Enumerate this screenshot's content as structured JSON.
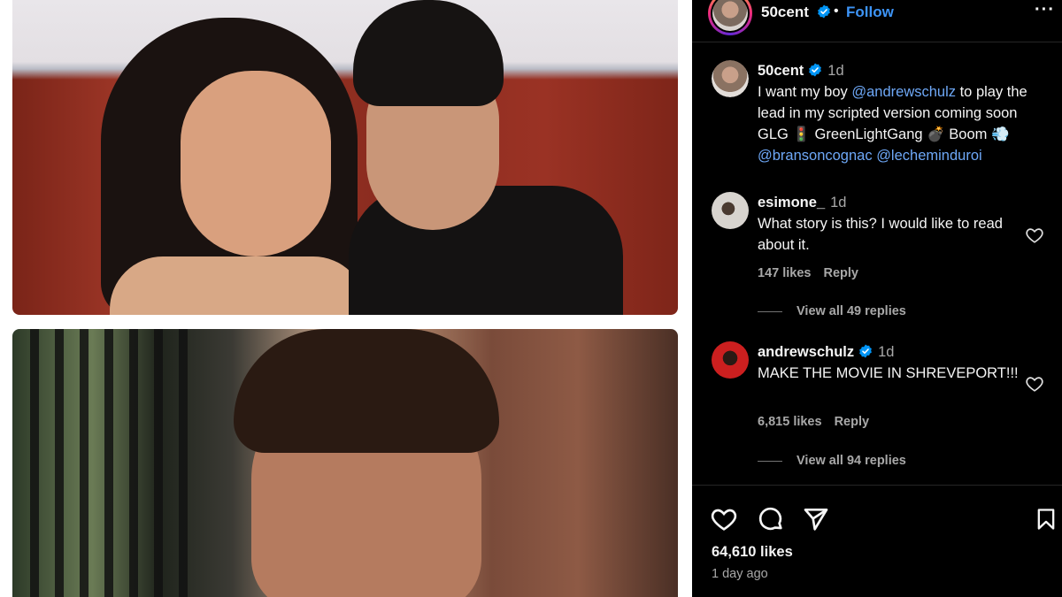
{
  "header": {
    "username": "50cent",
    "separator": "•",
    "follow_label": "Follow",
    "more_label": "···"
  },
  "caption": {
    "username": "50cent",
    "time": "1d",
    "text_1": "I want my boy ",
    "mention_1": "@andrewschulz",
    "text_2": " to play the lead in my scripted version coming soon GLG 🚦 GreenLightGang 💣 Boom 💨 ",
    "mention_2": "@bransoncognac",
    "text_3": " ",
    "mention_3": "@lecheminduroi"
  },
  "comments": [
    {
      "username": "esimone_",
      "time": "1d",
      "text": "What story is this? I would like to read about it.",
      "likes": "147 likes",
      "reply_label": "Reply",
      "view_replies": "View all 49 replies"
    },
    {
      "username": "andrewschulz",
      "time": "1d",
      "text": "MAKE THE MOVIE IN SHREVEPORT!!!",
      "likes": "6,815 likes",
      "reply_label": "Reply",
      "view_replies": "View all 94 replies"
    }
  ],
  "post": {
    "likes": "64,610 likes",
    "posted": "1 day ago"
  },
  "colors": {
    "background": "#000000",
    "link": "#3d94f6",
    "mention": "#6ea8f7",
    "muted": "#a8a8a8",
    "verified": "#0095f6"
  },
  "icons": {
    "like": "heart-icon",
    "comment": "comment-bubble-icon",
    "share": "paper-plane-icon",
    "save": "bookmark-icon",
    "verified": "verified-badge-icon",
    "more": "more-options-icon"
  }
}
